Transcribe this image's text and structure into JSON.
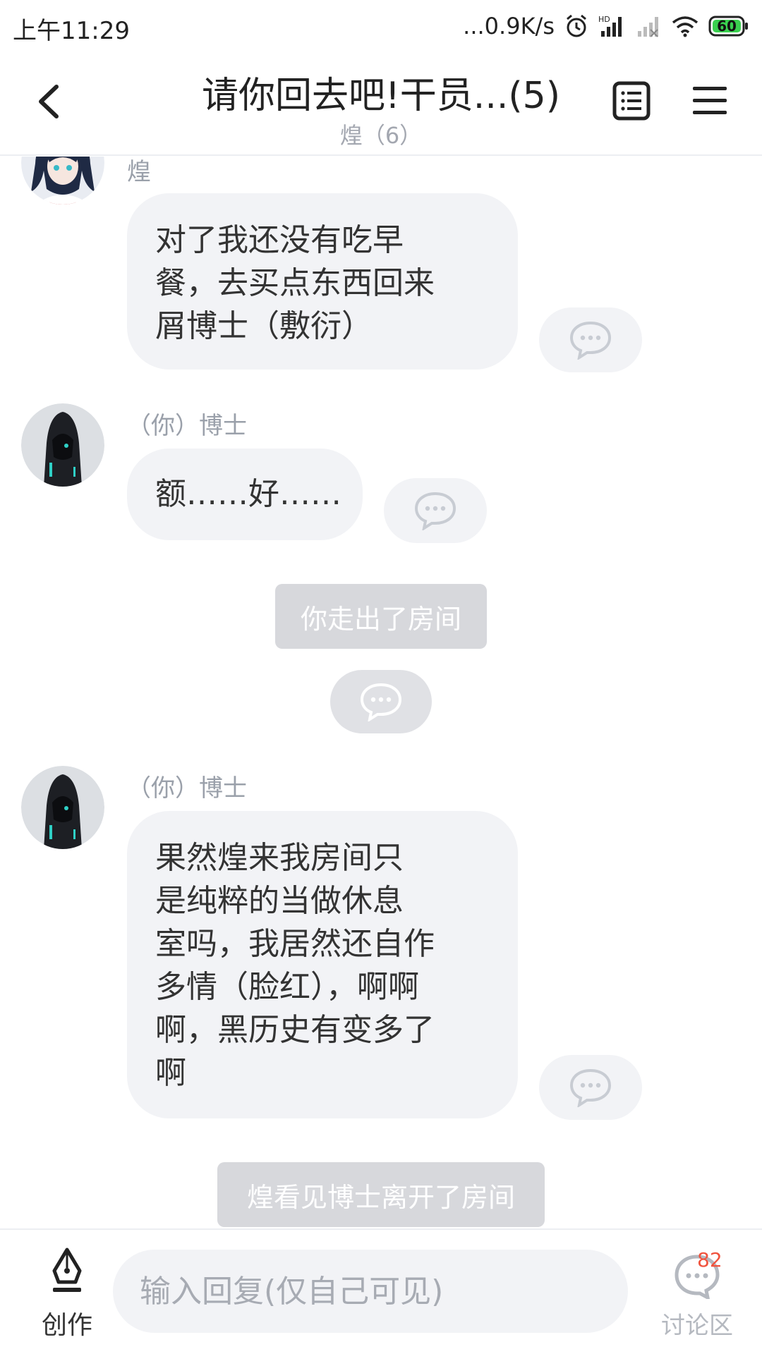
{
  "status_bar": {
    "time": "上午11:29",
    "net_speed": "...0.9K/s",
    "battery": "60"
  },
  "header": {
    "title": "请你回去吧!干员...(5)",
    "subtitle": "煌（6）"
  },
  "messages": [
    {
      "sender": "煌",
      "text": "对了我还没有吃早\n餐，去买点东西回来\n屑博士（敷衍）"
    },
    {
      "sender": "（你）博士",
      "text": "额……好……"
    },
    {
      "system": "你走出了房间"
    },
    {
      "sender": "（你）博士",
      "text": "果然煌来我房间只\n是纯粹的当做休息\n室吗，我居然还自作\n多情（脸红），啊啊\n啊，黑历史有变多了\n啊"
    },
    {
      "system": "煌看见博士离开了房间"
    }
  ],
  "bottom_bar": {
    "create_label": "创作",
    "reply_placeholder": "输入回复(仅自己可见)",
    "discuss_label": "讨论区",
    "discuss_badge": "82"
  },
  "colors": {
    "bubble": "#f2f3f6",
    "system_pill": "#d7d8dc",
    "badge": "#f0533e",
    "muted_text": "#9aa0aa"
  }
}
